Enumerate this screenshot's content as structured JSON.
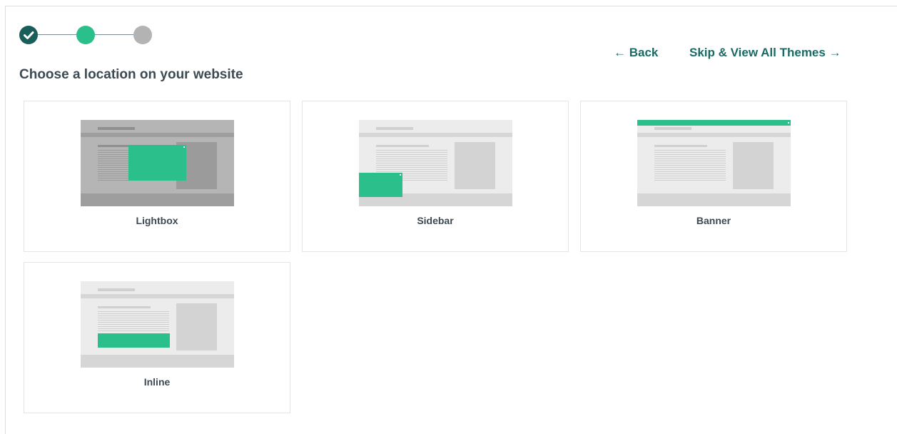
{
  "stepper": {
    "steps": [
      "completed",
      "current",
      "upcoming"
    ]
  },
  "header": {
    "title": "Choose a location on your website",
    "back_label": "← Back",
    "skip_label": "Skip & View All Themes →"
  },
  "colors": {
    "accent_green": "#2bbf8c",
    "dark_teal": "#1a5e5a",
    "link_color": "#1a6a63",
    "inactive_grey": "#b3b3b3"
  },
  "locations": [
    {
      "label": "Lightbox",
      "preview": "lightbox"
    },
    {
      "label": "Sidebar",
      "preview": "sidebar"
    },
    {
      "label": "Banner",
      "preview": "banner"
    },
    {
      "label": "Inline",
      "preview": "inline"
    }
  ]
}
